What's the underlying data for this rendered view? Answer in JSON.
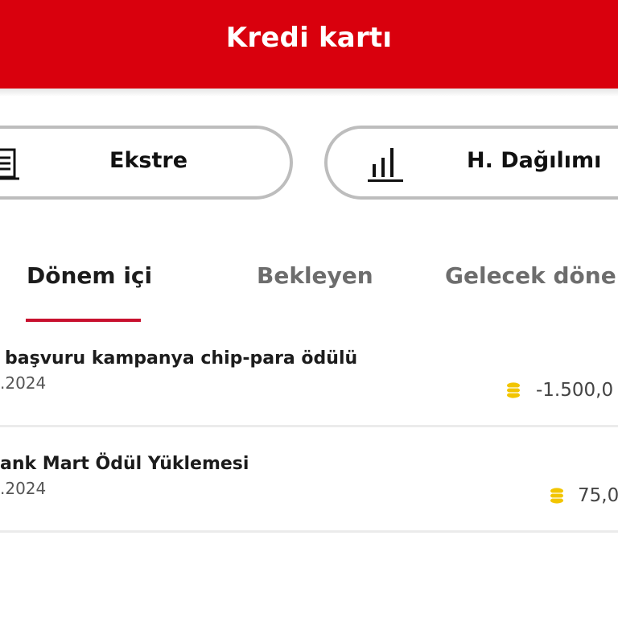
{
  "header": {
    "title": "Kredi kartı"
  },
  "actions": {
    "statement_label": "Ekstre",
    "statement_icon": "document-list-icon",
    "distribution_label": "H. Dağılımı",
    "distribution_icon": "bar-chart-icon"
  },
  "tabs": [
    {
      "label": "Dönem içi",
      "active": true
    },
    {
      "label": "Bekleyen",
      "active": false
    },
    {
      "label": "Gelecek dönem",
      "active": false
    }
  ],
  "transactions": [
    {
      "title": "başvuru kampanya chip-para ödülü",
      "date": ".2024",
      "amount": "-1.500,0",
      "icon": "coin-stack-icon"
    },
    {
      "title": "ank Mart Ödül Yüklemesi",
      "date": ".2024",
      "amount": "75,0",
      "icon": "coin-stack-icon"
    }
  ],
  "colors": {
    "brand_red": "#d9000d",
    "tab_indicator": "#c8102e",
    "coin_yellow": "#f2c500"
  }
}
